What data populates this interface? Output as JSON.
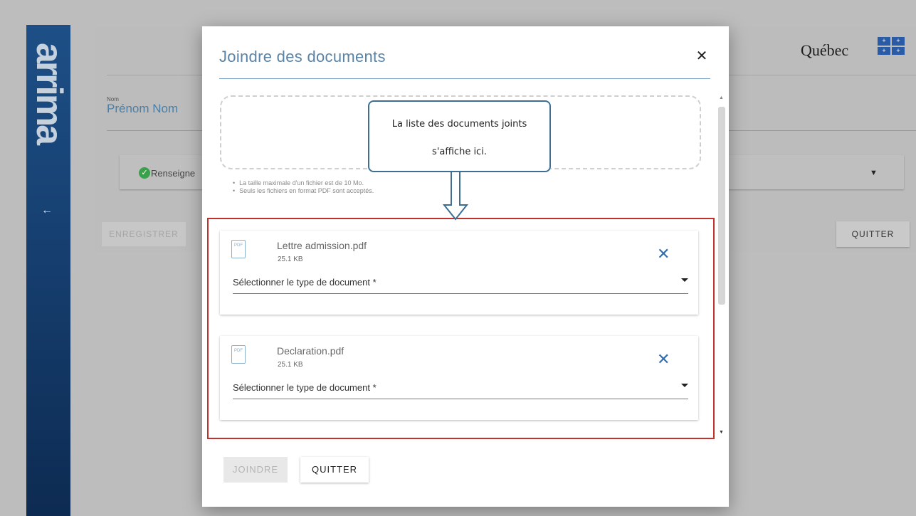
{
  "background": {
    "brand_logo": "arrima",
    "back_icon": "arrow-left-icon",
    "quebec_logo": "Québec",
    "field_label": "Nom",
    "field_value": "Prénom Nom",
    "section_label": "Renseigne",
    "save_button": "ENREGISTRER",
    "quit_button": "QUITTER"
  },
  "modal": {
    "title": "Joindre des documents",
    "hints": [
      "La taille maximale d'un fichier est de 10 Mo.",
      "Seuls les fichiers en format PDF sont acceptés."
    ],
    "documents": [
      {
        "file_type": "PDF",
        "name": "Lettre admission.pdf",
        "size": "25.1 KB",
        "select_label": "Sélectionner le type de document *"
      },
      {
        "file_type": "PDF",
        "name": "Declaration.pdf",
        "size": "25.1 KB",
        "select_label": "Sélectionner le type de document *"
      }
    ],
    "join_button": "JOINDRE",
    "quit_button": "QUITTER"
  },
  "callout": {
    "line1": "La liste des documents joints",
    "line2": "s'affiche ici."
  },
  "colors": {
    "accent": "#5a83a6",
    "highlight_border": "#c0312b",
    "remove_icon": "#2f6db0"
  }
}
